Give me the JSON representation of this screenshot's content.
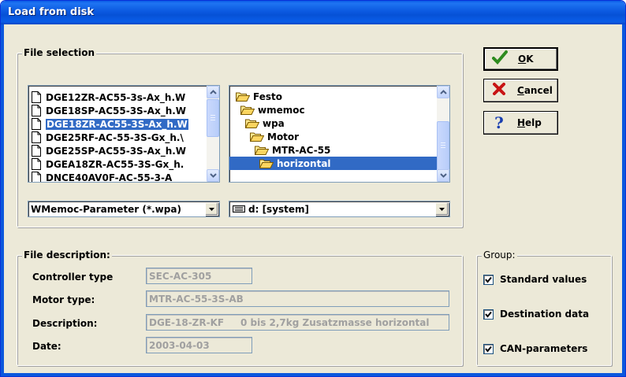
{
  "window": {
    "title": "Load from disk"
  },
  "file_selection": {
    "legend": "File selection",
    "files": [
      {
        "name": "DGE12ZR-AC55-3s-Ax_h.W",
        "selected": false
      },
      {
        "name": "DGE18SP-AC55-3S-Ax_h.W",
        "selected": false
      },
      {
        "name": "DGE18ZR-AC55-3S-Ax_h.W",
        "selected": true
      },
      {
        "name": "DGE25RF-AC-55-3S-Gx_h.\\",
        "selected": false
      },
      {
        "name": "DGE25SP-AC55-3S-Ax_h.W",
        "selected": false
      },
      {
        "name": "DGEA18ZR-AC55-3S-Gx_h.",
        "selected": false
      },
      {
        "name": "DNCE40AV0F-AC-55-3-A",
        "selected": false
      }
    ],
    "folders": [
      {
        "name": "Festo",
        "level": 0,
        "open": true,
        "selected": false
      },
      {
        "name": "wmemoc",
        "level": 1,
        "open": true,
        "selected": false
      },
      {
        "name": "wpa",
        "level": 2,
        "open": true,
        "selected": false
      },
      {
        "name": "Motor",
        "level": 3,
        "open": true,
        "selected": false
      },
      {
        "name": "MTR-AC-55",
        "level": 4,
        "open": true,
        "selected": false
      },
      {
        "name": "horizontal",
        "level": 5,
        "open": true,
        "selected": true
      }
    ],
    "file_type": "WMemoc-Parameter (*.wpa)",
    "drive": "d: [system]"
  },
  "buttons": {
    "ok": {
      "label": "OK",
      "underline_index": 0
    },
    "cancel": {
      "label": "Cancel",
      "underline_index": 0
    },
    "help": {
      "label": "Help",
      "underline_index": 0
    }
  },
  "file_description": {
    "legend": "File description:",
    "controller_type": {
      "label": "Controller type",
      "value": "SEC-AC-305"
    },
    "motor_type": {
      "label": "Motor type:",
      "value": "MTR-AC-55-3S-AB"
    },
    "description": {
      "label": "Description:",
      "value": "DGE-18-ZR-KF     0 bis 2,7kg Zusatzmasse horizontal"
    },
    "date": {
      "label": "Date:",
      "value": "2003-04-03"
    }
  },
  "group": {
    "legend": "Group:",
    "standard_values": {
      "label": "Standard values",
      "checked": true
    },
    "destination_data": {
      "label": "Destination data",
      "checked": true
    },
    "can_parameters": {
      "label": "CAN-parameters",
      "checked": true
    }
  },
  "colors": {
    "title_blue": "#0b59e0",
    "selection": "#316ac5",
    "dialog_bg": "#ece9d8",
    "ok_green": "#2e8b1f",
    "cancel_red": "#c81414",
    "help_blue": "#1a3fb0"
  },
  "icons": {
    "ok": "check-icon",
    "cancel": "x-icon",
    "help": "question-icon",
    "file": "document-icon",
    "folder": "open-folder-icon",
    "drive": "drive-icon"
  }
}
